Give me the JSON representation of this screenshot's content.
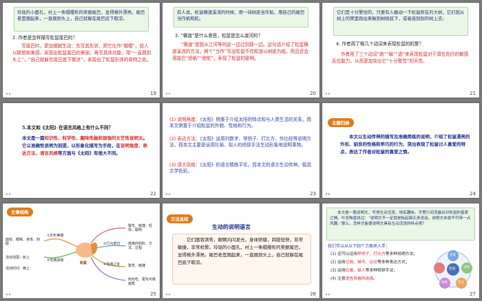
{
  "slides": [
    {
      "number": "19",
      "box_text": "玲珑的小面孔，衬上一条帽缨形的美丽尾巴，显得格外漂亮。尾巴老是翘起来，一直翘到头上，自己就躲在尾巴底下歇凉。",
      "question": "2. 作者是怎样描写松鼠尾巴的？",
      "answer": "写尾巴时，更加细腻生动：先写其形状，把它比作“帽缨”，给人以联想和美感，表现出松鼠尾巴的美丽；再写具体功能，用“一直翘到头上”，“自己就躲在尾巴底下歇凉”，表现出了松鼠形体的奇特之处。"
    },
    {
      "number": "20",
      "box_text": "有人说，松鼠横渡溪流的时候，用一块树皮当作船，用自己的尾巴当作帆和舵。",
      "question": "3. “横渡”是什么意思，松鼠是怎么渡河的？",
      "answer": "“横渡”是指从江河等的这一边过到那一边。这句话介绍了松鼠横渡溪流的方法，两个“当作”写出松鼠不仅知道以树皮为船，而且还会用尾巴“扬帆”“使舵”，表现了松鼠的聪明。"
    },
    {
      "number": "21",
      "box_text": "它们是十分警觉的，只要有人触动一下松鼠所在的大树，它们就从树上的窝里跑出来躲到树枝底下，或者逃到别的树上去。",
      "question": "4. 作者用了哪几个动词来表现松鼠的机警？",
      "answer": "作者用了三个动词“跑”“躲”“逃”来表现松鼠对于潜在危险的敏感反应能力，从而更加突出它“十分警觉”的天性。"
    },
    {
      "number": "22",
      "question_parts": [
        "5.本文和《太阳》在语言风格上有什么不同？"
      ],
      "text_a": "本文是一篇",
      "text_b": "知识性、科学性、趣味性融和很强的文艺性说明文",
      "text_c": "。它以准确性说明为前提，以形象化描写为手段，在",
      "text_d": "说明角度、表达方法、语言风格",
      "text_e": "等方面与《太阳》有很大不同。"
    },
    {
      "number": "23",
      "items": [
        {
          "head": "(1) 说明角度：",
          "body": "《太阳》侧重于介绍太阳的特点和与人类生活的关系，而本文侧重于介绍松鼠的外貌、性格和行为。"
        },
        {
          "head": "(2) 表达方法：",
          "body": "《太阳》运用列数字、举例子、打比方、作比较等说明方法，而本文主要是运用比喻、拟人的修辞手法生动形象地说明事物。"
        },
        {
          "head": "(3) 语言风格：",
          "body": "《太阳》的语言精练平实，而本文的语言生动传神，极具文学色彩。"
        }
      ]
    },
    {
      "number": "24",
      "tag": "主题归纳",
      "text_a": "本文以生动传神的描写及准确简练的说明，介绍了松鼠漂亮的外形、驯良的性格和乖巧的行为，突出表现了松鼠讨人喜爱的特点，表达了作者对松鼠的喜爱之情。"
    },
    {
      "number": "25",
      "tag": "文章结构",
      "center": "松鼠",
      "branches": [
        "①外形美丽",
        "②性格驯良",
        "③行为乖巧",
        "④有用之处"
      ],
      "leaves": [
        "面容、眼睛、身体、四肢",
        "活动范围：树上",
        "活动时间：晚上",
        "警觉、敏捷、轻快、聪明",
        "搭窝的材料、方法、过程",
        "警觉、敏捷",
        "肉可吃、尾毛可做画笔"
      ]
    },
    {
      "number": "26",
      "tag": "方法总结",
      "title": "生动的说明语言",
      "box_text": "它们面容清秀，眼睛闪闪发光，身体矫健，四肢轻快，非常敏捷，非常机警。玲珑的小面孔，衬上一条帽缨形的美丽尾巴，显得格外漂亮。尾巴老是翘起来，一直翘到头上，自己就躲在尾巴底下歇凉。"
    },
    {
      "number": "27",
      "box_text": "本文是一篇说明文，写得生动活泼，饶有趣味，字里行间流露出对松鼠的喜爱之情。叶圣陶曾说过：“说明文不一定就是板起面孔来说话，说明文未尝不可带一点风趣。”那么，怎样才能使说明文具有生动活泼的特点呢？",
      "question": "我们可以从以下四个方面来入手：",
      "items": [
        {
          "head": "(1) 还可以运用",
          "hl": "举例子、打比方",
          "tail": "等多种说明方法；"
        },
        {
          "head": "(2) 运用",
          "hl": "记叙、描写、议论",
          "tail": "等多种表达方式；"
        },
        {
          "head": "(3) 运用",
          "hl": "比喻、拟人",
          "tail": "等多种修辞手法；"
        },
        {
          "head": "(4) 注意",
          "hl": "语言风格的选择",
          "tail": "。"
        }
      ],
      "wheel": [
        "生动",
        "活泼",
        "说明",
        "方法",
        "修辞"
      ]
    }
  ],
  "controls": "◂ ▸"
}
